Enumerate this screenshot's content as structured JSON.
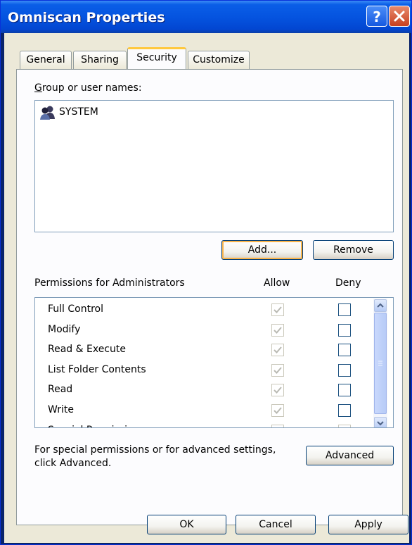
{
  "window": {
    "title": "Omniscan Properties"
  },
  "tabs": [
    {
      "label": "General"
    },
    {
      "label": "Sharing"
    },
    {
      "label": "Security"
    },
    {
      "label": "Customize"
    }
  ],
  "groups": {
    "label": "Group or user names:",
    "users": [
      {
        "name": "SYSTEM",
        "icon": "users-group-icon"
      }
    ]
  },
  "buttons": {
    "add": "Add...",
    "remove": "Remove",
    "advanced": "Advanced",
    "ok": "OK",
    "cancel": "Cancel",
    "apply": "Apply"
  },
  "permissions": {
    "label": "Permissions for Administrators",
    "allow_header": "Allow",
    "deny_header": "Deny",
    "rows": [
      {
        "name": "Full Control",
        "allow": true,
        "deny": false
      },
      {
        "name": "Modify",
        "allow": true,
        "deny": false
      },
      {
        "name": "Read & Execute",
        "allow": true,
        "deny": false
      },
      {
        "name": "List Folder Contents",
        "allow": true,
        "deny": false
      },
      {
        "name": "Read",
        "allow": true,
        "deny": false
      },
      {
        "name": "Write",
        "allow": true,
        "deny": false
      },
      {
        "name": "Special Permissions",
        "allow": false,
        "deny": false
      }
    ]
  },
  "advanced_note": {
    "line1": "For special permissions or for advanced settings,",
    "line2": "click Advanced."
  },
  "colors": {
    "titlebar": "#0554e0",
    "dialog": "#ece9d8",
    "tab_highlight": "#ffc83c"
  }
}
